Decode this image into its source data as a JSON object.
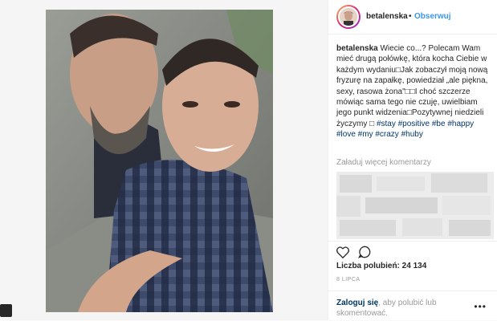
{
  "header": {
    "username": "betalenska",
    "separator": "•",
    "follow_label": "Obserwuj"
  },
  "caption": {
    "username": "betalenska",
    "text": "Wiecie co...? Polecam Wam mieć drugą połówkę, która kocha Ciebie w każdym wydaniu□Jak zobaczył moją nową fryzurę na zapałkę, powiedział „ale piękna, sexy, rasowa żona\"□□I choć szczerze mówiąc sama tego nie czuję, uwielbiam jego punkt widzenia□Pozytywnej niedzieli życzymy □",
    "hashtags": "#stay #positive #be #happy #love #my #crazy #huby"
  },
  "comments": {
    "load_more": "Załaduj więcej komentarzy"
  },
  "icons": {
    "like": "heart-icon",
    "comment": "comment-icon",
    "tag": "user-tag-icon",
    "more": "more-options-icon"
  },
  "stats": {
    "likes_label": "Liczba polubień:",
    "likes_count": "24 134",
    "date": "8 LIPCA"
  },
  "footer": {
    "login_link": "Zaloguj się",
    "login_text": ", aby polubić lub skomentować."
  },
  "colors": {
    "link": "#3897f0",
    "hashtag": "#003569",
    "muted": "#999999",
    "text": "#262626"
  }
}
